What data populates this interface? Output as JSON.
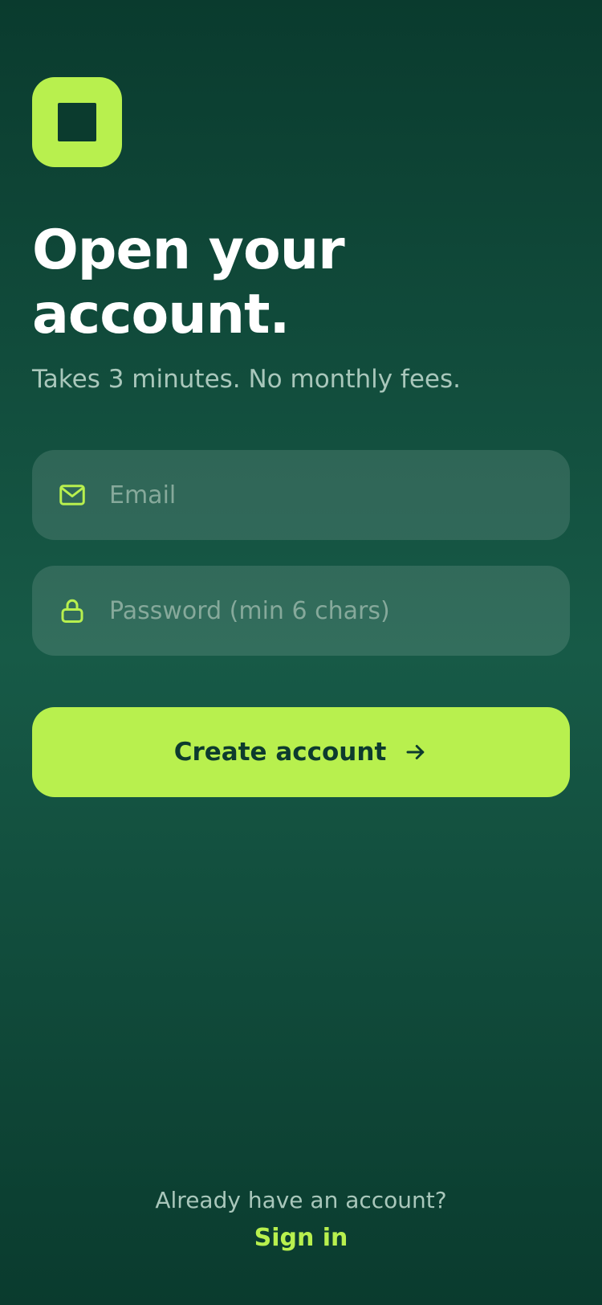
{
  "app": {
    "brand_color": "#b8f04e",
    "background_color": "#0f4a3a"
  },
  "logo": {
    "icon": "square-logo-icon"
  },
  "header": {
    "title_line1": "Open your",
    "title_line2": "account.",
    "subtitle": "Takes 3 minutes. No monthly fees."
  },
  "form": {
    "email": {
      "icon": "mail-icon",
      "placeholder": "Email",
      "value": ""
    },
    "password": {
      "icon": "lock-icon",
      "placeholder": "Password (min 6 chars)",
      "value": ""
    },
    "submit": {
      "label": "Create account",
      "icon": "arrow-right-icon"
    }
  },
  "footer": {
    "prompt": "Already have an account?",
    "signin_label": "Sign in"
  }
}
